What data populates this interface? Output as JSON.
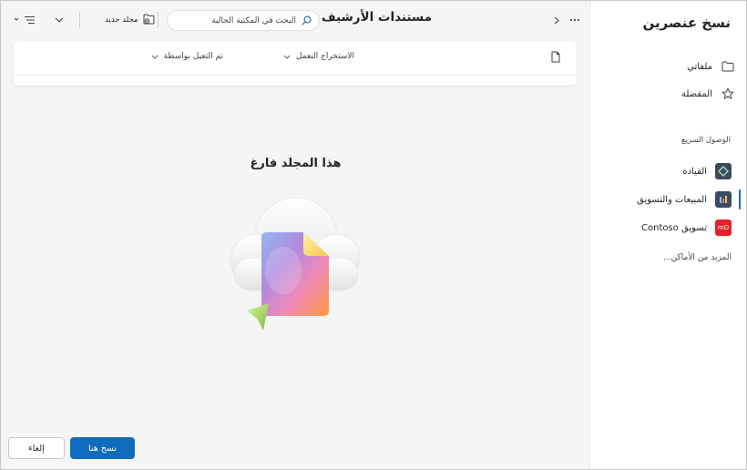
{
  "dialog": {
    "title": "نسخ عنصرين"
  },
  "nav": {
    "items": [
      {
        "label": "ملفاتي",
        "icon": "folder-icon"
      },
      {
        "label": "المفضلة",
        "icon": "star-icon"
      }
    ],
    "quick_access_label": "الوصول السريع",
    "quick_access": [
      {
        "label": "القيادة",
        "tile_color": "#3b4a5a",
        "tile_text": ""
      },
      {
        "label": "المبيعات والتسويق",
        "tile_color": "#3a4b62",
        "tile_text": ""
      },
      {
        "label": "تسويق Contoso",
        "tile_color": "#e8202a",
        "tile_text": "mO"
      }
    ],
    "more_places": "المزيد من الأماكن..."
  },
  "toolbar": {
    "breadcrumb": "مستندات الأرشيف",
    "search_placeholder": "البحث في المكتبة الحالية",
    "new_folder": "مجلد جديد"
  },
  "columns": [
    {
      "label": "الاستخراج التعمل"
    },
    {
      "label": "تم التعيل بواسطة"
    }
  ],
  "empty_state": {
    "title": "هذا المجلد فارغ"
  },
  "footer": {
    "copy_here": "نسخ هنا",
    "cancel": "إلغاء"
  },
  "colors": {
    "accent": "#0f6cbd"
  }
}
